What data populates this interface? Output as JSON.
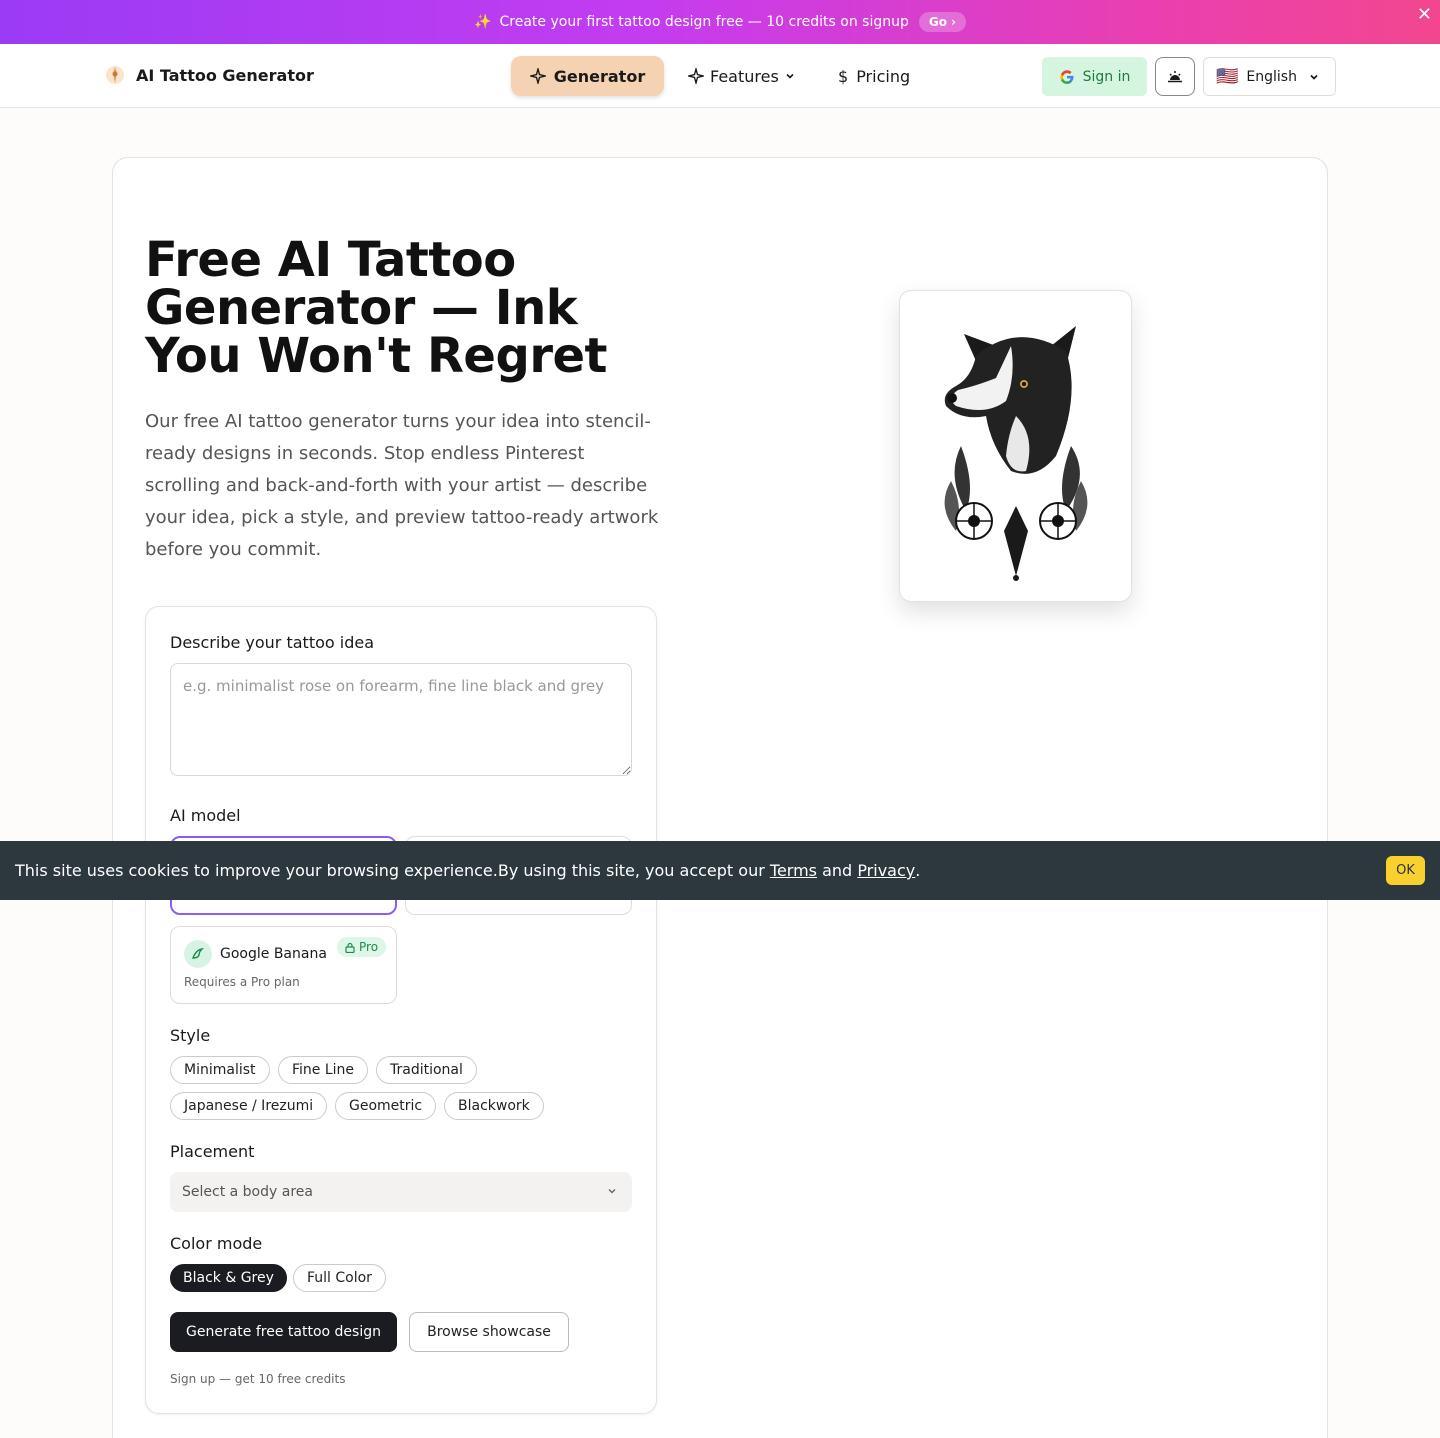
{
  "promo": {
    "sparkle": "✨",
    "text": "Create your first tattoo design free — 10 credits on signup",
    "go_label": "Go",
    "close_label": "✕"
  },
  "header": {
    "logo_text": "AI Tattoo Generator",
    "nav": {
      "generator": "Generator",
      "features": "Features",
      "pricing": "Pricing"
    },
    "signin": "Sign in",
    "language": "English",
    "language_flag": "🇺🇸"
  },
  "hero": {
    "title": "Free AI Tattoo Generator — Ink You Won't Regret",
    "description": "Our free AI tattoo generator turns your idea into stencil-ready designs in seconds. Stop endless Pinterest scrolling and back-and-forth with your artist — describe your idea, pick a style, and preview tattoo-ready artwork before you commit."
  },
  "form": {
    "idea_label": "Describe your tattoo idea",
    "idea_placeholder": "e.g. minimalist rose on forearm, fine line black and grey",
    "model_label": "AI model",
    "models": [
      {
        "name": "Google Banana",
        "badge": "Pro",
        "sub": "Requires a Pro plan"
      }
    ],
    "style_label": "Style",
    "styles": [
      "Minimalist",
      "Fine Line",
      "Traditional",
      "Japanese / Irezumi",
      "Geometric",
      "Blackwork"
    ],
    "placement_label": "Placement",
    "placement_placeholder": "Select a body area",
    "color_label": "Color mode",
    "color_modes": [
      "Black & Grey",
      "Full Color"
    ],
    "generate_label": "Generate free tattoo design",
    "browse_label": "Browse showcase",
    "signup_note": "Sign up — get 10 free credits"
  },
  "cookie": {
    "text": "This site uses cookies to improve your browsing experience.By using this site, you accept our",
    "terms": "Terms",
    "and": "and",
    "privacy": "Privacy",
    "period": ".",
    "ok": "OK"
  },
  "colors": {
    "accent": "#8b5cf6",
    "nav_active": "#f5d3b2",
    "dark_button": "#1b1b22",
    "cookie_bg": "#2c373e",
    "ok_button": "#f8d12f"
  }
}
